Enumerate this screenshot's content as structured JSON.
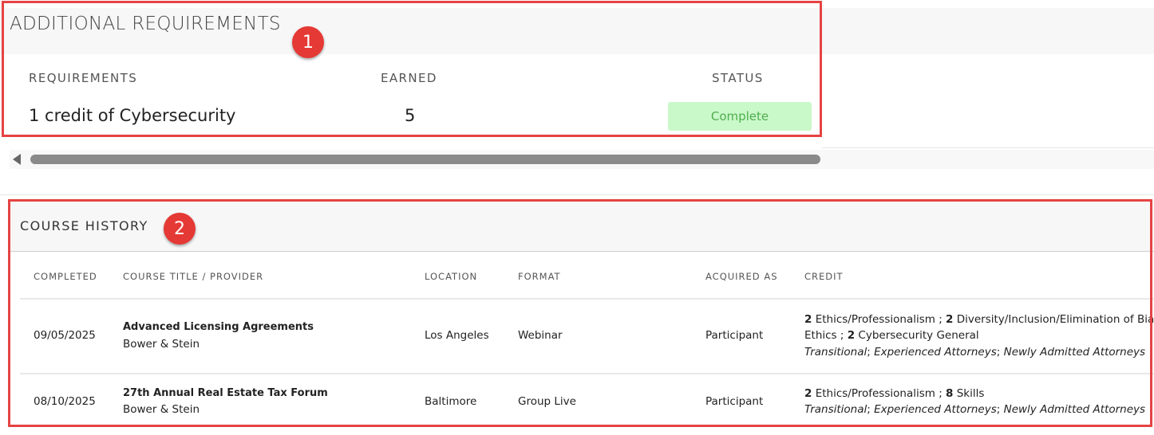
{
  "additional_requirements": {
    "title": "ADDITIONAL REQUIREMENTS",
    "columns": {
      "requirements": "REQUIREMENTS",
      "earned": "EARNED",
      "status": "STATUS"
    },
    "rows": [
      {
        "requirement": "1 credit of Cybersecurity",
        "earned": "5",
        "status": "Complete",
        "status_color": "#c9f8c9"
      }
    ]
  },
  "course_history": {
    "title": "COURSE HISTORY",
    "columns": {
      "completed": "COMPLETED",
      "title_provider": "COURSE TITLE / PROVIDER",
      "location": "LOCATION",
      "format": "FORMAT",
      "acquired_as": "ACQUIRED AS",
      "credit": "CREDIT"
    },
    "rows": [
      {
        "completed": "09/05/2025",
        "title": "Advanced Licensing Agreements",
        "provider": "Bower & Stein",
        "location": "Los Angeles",
        "format": "Webinar",
        "acquired_as": "Participant",
        "credit_line1": {
          "n1": "2",
          "t1": " Ethics/Professionalism ; ",
          "n2": "2",
          "t2": " Diversity/Inclusion/Elimination of Bias"
        },
        "credit_line2": {
          "t1": "Ethics ; ",
          "n1": "2",
          "t2": " Cybersecurity General"
        },
        "credit_tags": {
          "a": "Transitional",
          "sep1": "; ",
          "b": "Experienced Attorneys",
          "sep2": "; ",
          "c": "Newly Admitted Attorneys"
        }
      },
      {
        "completed": "08/10/2025",
        "title": "27th Annual Real Estate Tax Forum",
        "provider": "Bower & Stein",
        "location": "Baltimore",
        "format": "Group Live",
        "acquired_as": "Participant",
        "credit_line1": {
          "n1": "2",
          "t1": " Ethics/Professionalism ; ",
          "n2": "8",
          "t2": " Skills"
        },
        "credit_tags": {
          "a": "Transitional",
          "sep1": "; ",
          "b": "Experienced Attorneys",
          "sep2": "; ",
          "c": "Newly Admitted Attorneys"
        }
      }
    ]
  },
  "annotations": {
    "badge1": "1",
    "badge2": "2",
    "color": "#e53935"
  }
}
